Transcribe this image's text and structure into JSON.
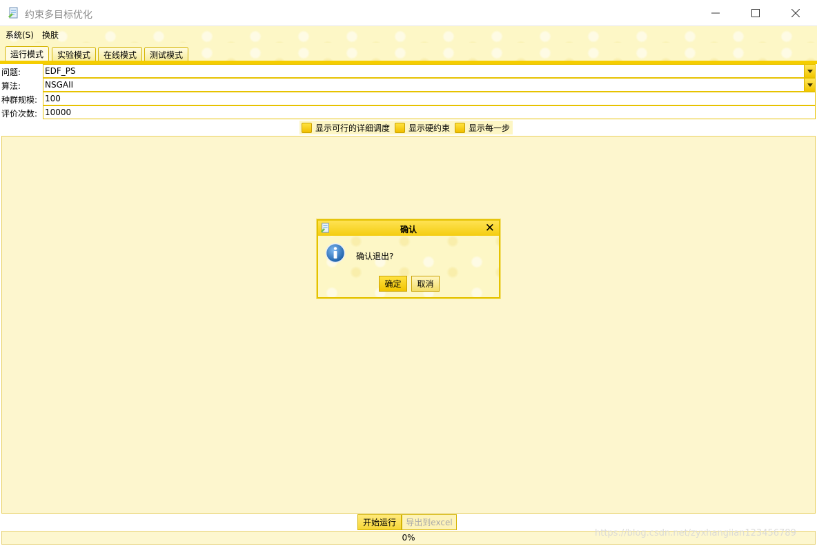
{
  "window": {
    "title": "约束多目标优化",
    "icons": {
      "app": "document-edit-icon",
      "minimize": "minimize-icon",
      "maximize": "maximize-icon",
      "close": "close-icon"
    }
  },
  "menubar": {
    "system": "系统(S)",
    "skin": "换肤"
  },
  "tabs": [
    {
      "label": "运行模式",
      "active": true
    },
    {
      "label": "实验模式",
      "active": false
    },
    {
      "label": "在线模式",
      "active": false
    },
    {
      "label": "测试模式",
      "active": false
    }
  ],
  "form": {
    "problem": {
      "label": "问题:",
      "value": "EDF_PS"
    },
    "algorithm": {
      "label": "算法:",
      "value": "NSGAII"
    },
    "population": {
      "label": "种群规模:",
      "value": "100"
    },
    "evaluations": {
      "label": "评价次数:",
      "value": "10000"
    }
  },
  "checkboxes": [
    {
      "label": "显示可行的详细调度",
      "checked": false
    },
    {
      "label": "显示硬约束",
      "checked": false
    },
    {
      "label": "显示每一步",
      "checked": false
    }
  ],
  "buttons": {
    "start": "开始运行",
    "export": "导出到excel"
  },
  "progress": {
    "text": "0%",
    "value": 0
  },
  "watermark": "https://blog.csdn.net/zyxhangiian123456789",
  "dialog": {
    "title": "确认",
    "message": "确认退出?",
    "ok": "确定",
    "cancel": "取消",
    "icon": "info-icon"
  },
  "colors": {
    "accent": "#f5cd00",
    "panel": "#fdf6ce",
    "border": "#e7c200"
  }
}
